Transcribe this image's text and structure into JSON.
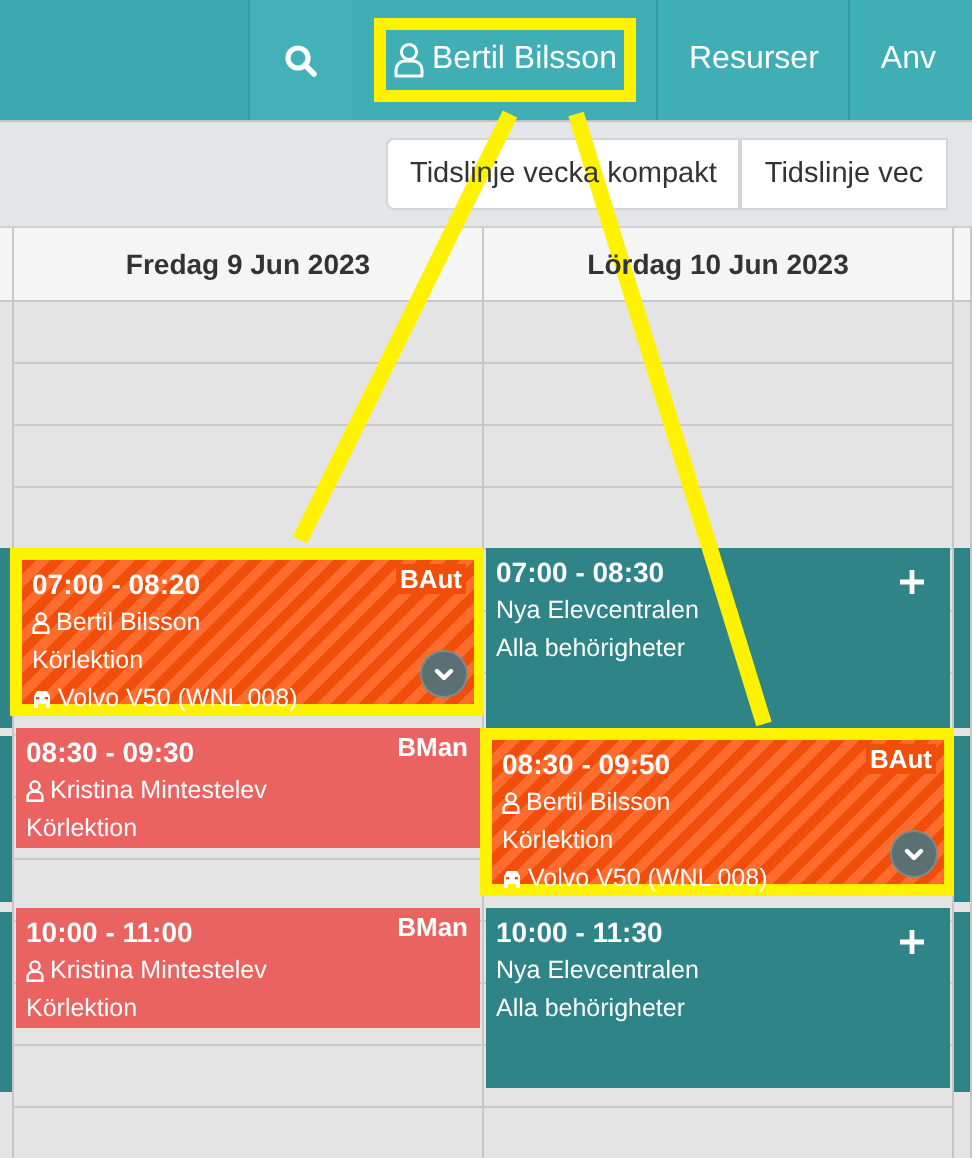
{
  "nav": {
    "items": [
      {
        "kind": "search",
        "highlighted": false
      },
      {
        "kind": "user",
        "label": "Bertil Bilsson",
        "highlighted": true
      },
      {
        "kind": "link",
        "label": "Resurser",
        "highlighted": false
      },
      {
        "kind": "link",
        "label": "Anv",
        "highlighted": false
      }
    ]
  },
  "view_buttons": [
    {
      "label": "Tidslinje vecka kompakt"
    },
    {
      "label": "Tidslinje vec"
    }
  ],
  "days": [
    {
      "label": "Fredag 9 Jun 2023",
      "events": [
        {
          "kind": "own_booking",
          "time": "07:00 - 08:20",
          "badge": "BAut",
          "person": "Bertil Bilsson",
          "type": "Körlektion",
          "vehicle": "Volvo V50 (WNL 008)",
          "expandable": true,
          "highlighted": true
        },
        {
          "kind": "booking",
          "time": "08:30 - 09:30",
          "badge": "BMan",
          "person": "Kristina Mintestelev",
          "type": "Körlektion",
          "expandable": false,
          "highlighted": false
        },
        {
          "kind": "booking",
          "time": "10:00 - 11:00",
          "badge": "BMan",
          "person": "Kristina Mintestelev",
          "type": "Körlektion",
          "expandable": false,
          "highlighted": false
        }
      ]
    },
    {
      "label": "Lördag 10 Jun 2023",
      "events": [
        {
          "kind": "open_slot",
          "time": "07:00 - 08:30",
          "place": "Nya Elevcentralen",
          "type": "Alla behörigheter",
          "highlighted": false
        },
        {
          "kind": "own_booking",
          "time": "08:30 - 09:50",
          "badge": "BAut",
          "person": "Bertil Bilsson",
          "type": "Körlektion",
          "vehicle": "Volvo V50 (WNL 008)",
          "expandable": true,
          "highlighted": true
        },
        {
          "kind": "open_slot",
          "time": "10:00 - 11:30",
          "place": "Nya Elevcentralen",
          "type": "Alla behörigheter",
          "highlighted": false
        }
      ]
    }
  ]
}
